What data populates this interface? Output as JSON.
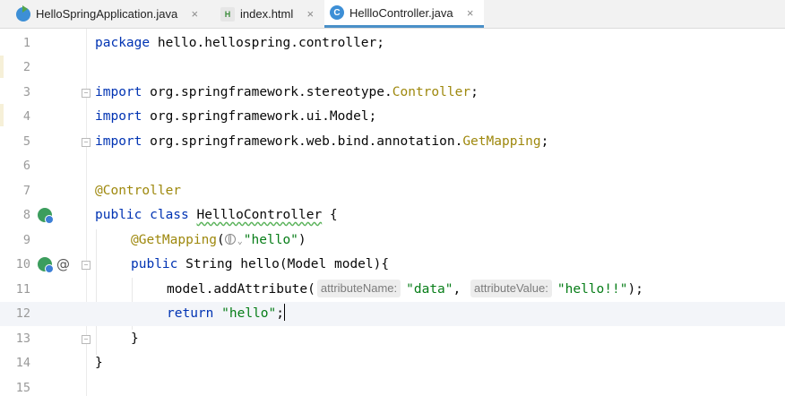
{
  "tabs": [
    {
      "label": "HelloSpringApplication.java",
      "icon": "java-application-icon",
      "active": false
    },
    {
      "label": "index.html",
      "icon": "html-file-icon",
      "active": false
    },
    {
      "label": "HellloController.java",
      "icon": "java-class-icon",
      "active": true
    }
  ],
  "tab_icon_letters": {
    "html": "H",
    "class": "C"
  },
  "close_glyph": "×",
  "lines": {
    "n1": "1",
    "n2": "2",
    "n3": "3",
    "n4": "4",
    "n5": "5",
    "n6": "6",
    "n7": "7",
    "n8": "8",
    "n9": "9",
    "n10": "10",
    "n11": "11",
    "n12": "12",
    "n13": "13",
    "n14": "14",
    "n15": "15"
  },
  "code": {
    "l1_kw": "package",
    "l1_rest": " hello.hellospring.controller;",
    "l3_kw": "import",
    "l3_rest": " org.springframework.stereotype.",
    "l3_cls": "Controller",
    "l3_end": ";",
    "l4_kw": "import",
    "l4_rest": " org.springframework.ui.Model;",
    "l5_kw": "import",
    "l5_rest": " org.springframework.web.bind.annotation.",
    "l5_cls": "GetMapping",
    "l5_end": ";",
    "l7_ann": "@Controller",
    "l8_kw": "public class",
    "l8_sp": " ",
    "l8_name": "HellloController",
    "l8_end": " {",
    "l9_ann": "@GetMapping",
    "l9_open": "(",
    "l9_chev": "⌄",
    "l9_str": "\"hello\"",
    "l9_close": ")",
    "l10_kw": "public",
    "l10_rest": " String hello(Model model){",
    "l11_call": "model.addAttribute(",
    "l11_hint1": "attributeName:",
    "l11_str1": "\"data\"",
    "l11_comma": ",",
    "l11_hint2": "attributeValue:",
    "l11_str2": "\"hello!!\"",
    "l11_end": ");",
    "l12_kw": "return",
    "l12_sp": " ",
    "l12_str": "\"hello\"",
    "l12_end": ";",
    "l13_brace": "}",
    "l14_brace": "}"
  },
  "at_glyph": "@",
  "colors": {
    "keyword": "#0033b3",
    "annotation": "#9e880d",
    "string": "#067d17",
    "active_tab_underline": "#4a90c8"
  }
}
